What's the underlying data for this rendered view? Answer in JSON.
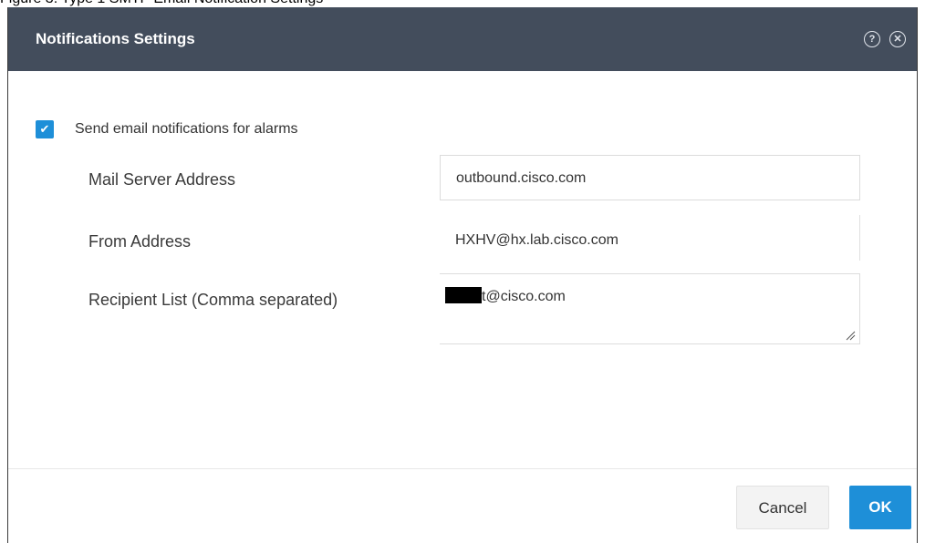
{
  "caption": "Figure 3:  Type 1 SMTP Email Notification Settings",
  "dialog": {
    "title": "Notifications Settings",
    "help_icon": "question-circle-icon",
    "close_icon": "close-circle-icon"
  },
  "checkbox": {
    "label": "Send email notifications for alarms",
    "checked": true
  },
  "fields": {
    "mail_server": {
      "label": "Mail Server Address",
      "value": "outbound.cisco.com"
    },
    "from_address": {
      "label": "From Address",
      "value": "HXHV@hx.lab.cisco.com"
    },
    "recipients": {
      "label": "Recipient List (Comma separated)",
      "value_suffix": "t@cisco.com"
    }
  },
  "buttons": {
    "cancel": "Cancel",
    "ok": "OK"
  },
  "colors": {
    "titlebar": "#434d5c",
    "accent": "#1e8fd8"
  }
}
